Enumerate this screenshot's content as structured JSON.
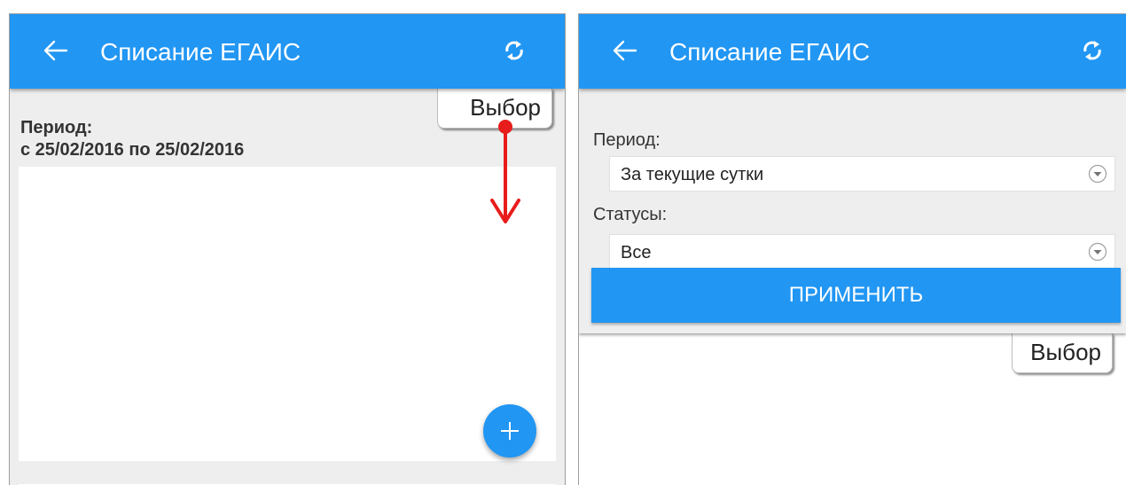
{
  "colors": {
    "accent": "#2196f3",
    "annotation_arrow": "#e81c1c"
  },
  "left_screen": {
    "appbar": {
      "back_icon": "arrow-left-icon",
      "title": "Списание ЕГАИС",
      "refresh_icon": "refresh-icon"
    },
    "filter_tab": {
      "label": "Выбор"
    },
    "summary": {
      "period_label": "Период:",
      "period_value": "с 25/02/2016 по 25/02/2016"
    },
    "fab": {
      "icon": "plus-icon"
    }
  },
  "right_screen": {
    "appbar": {
      "back_icon": "arrow-left-icon",
      "title": "Списание ЕГАИС",
      "refresh_icon": "refresh-icon"
    },
    "filter_panel": {
      "period_label": "Период:",
      "period_selected": "За текущие сутки",
      "status_label": "Статусы:",
      "status_selected": "Все",
      "apply_label": "ПРИМЕНИТЬ"
    },
    "filter_tab": {
      "label": "Выбор"
    }
  },
  "annotation": {
    "type": "drag-down-arrow"
  }
}
